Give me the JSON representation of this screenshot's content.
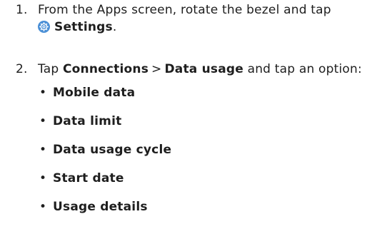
{
  "steps": [
    {
      "number": "1.",
      "text_before": "From the Apps screen, rotate the bezel and tap",
      "icon": "settings-gear-icon",
      "bold_term": "Settings",
      "text_after": "."
    },
    {
      "number": "2.",
      "text_before": "Tap",
      "bold_term_1": "Connections",
      "separator": ">",
      "bold_term_2": "Data usage",
      "text_after": "and tap an option:"
    }
  ],
  "options": [
    "Mobile data",
    "Data limit",
    "Data usage cycle",
    "Start date",
    "Usage details"
  ],
  "colors": {
    "text": "#1e1e1e",
    "settings_icon": "#4a8fd6"
  }
}
